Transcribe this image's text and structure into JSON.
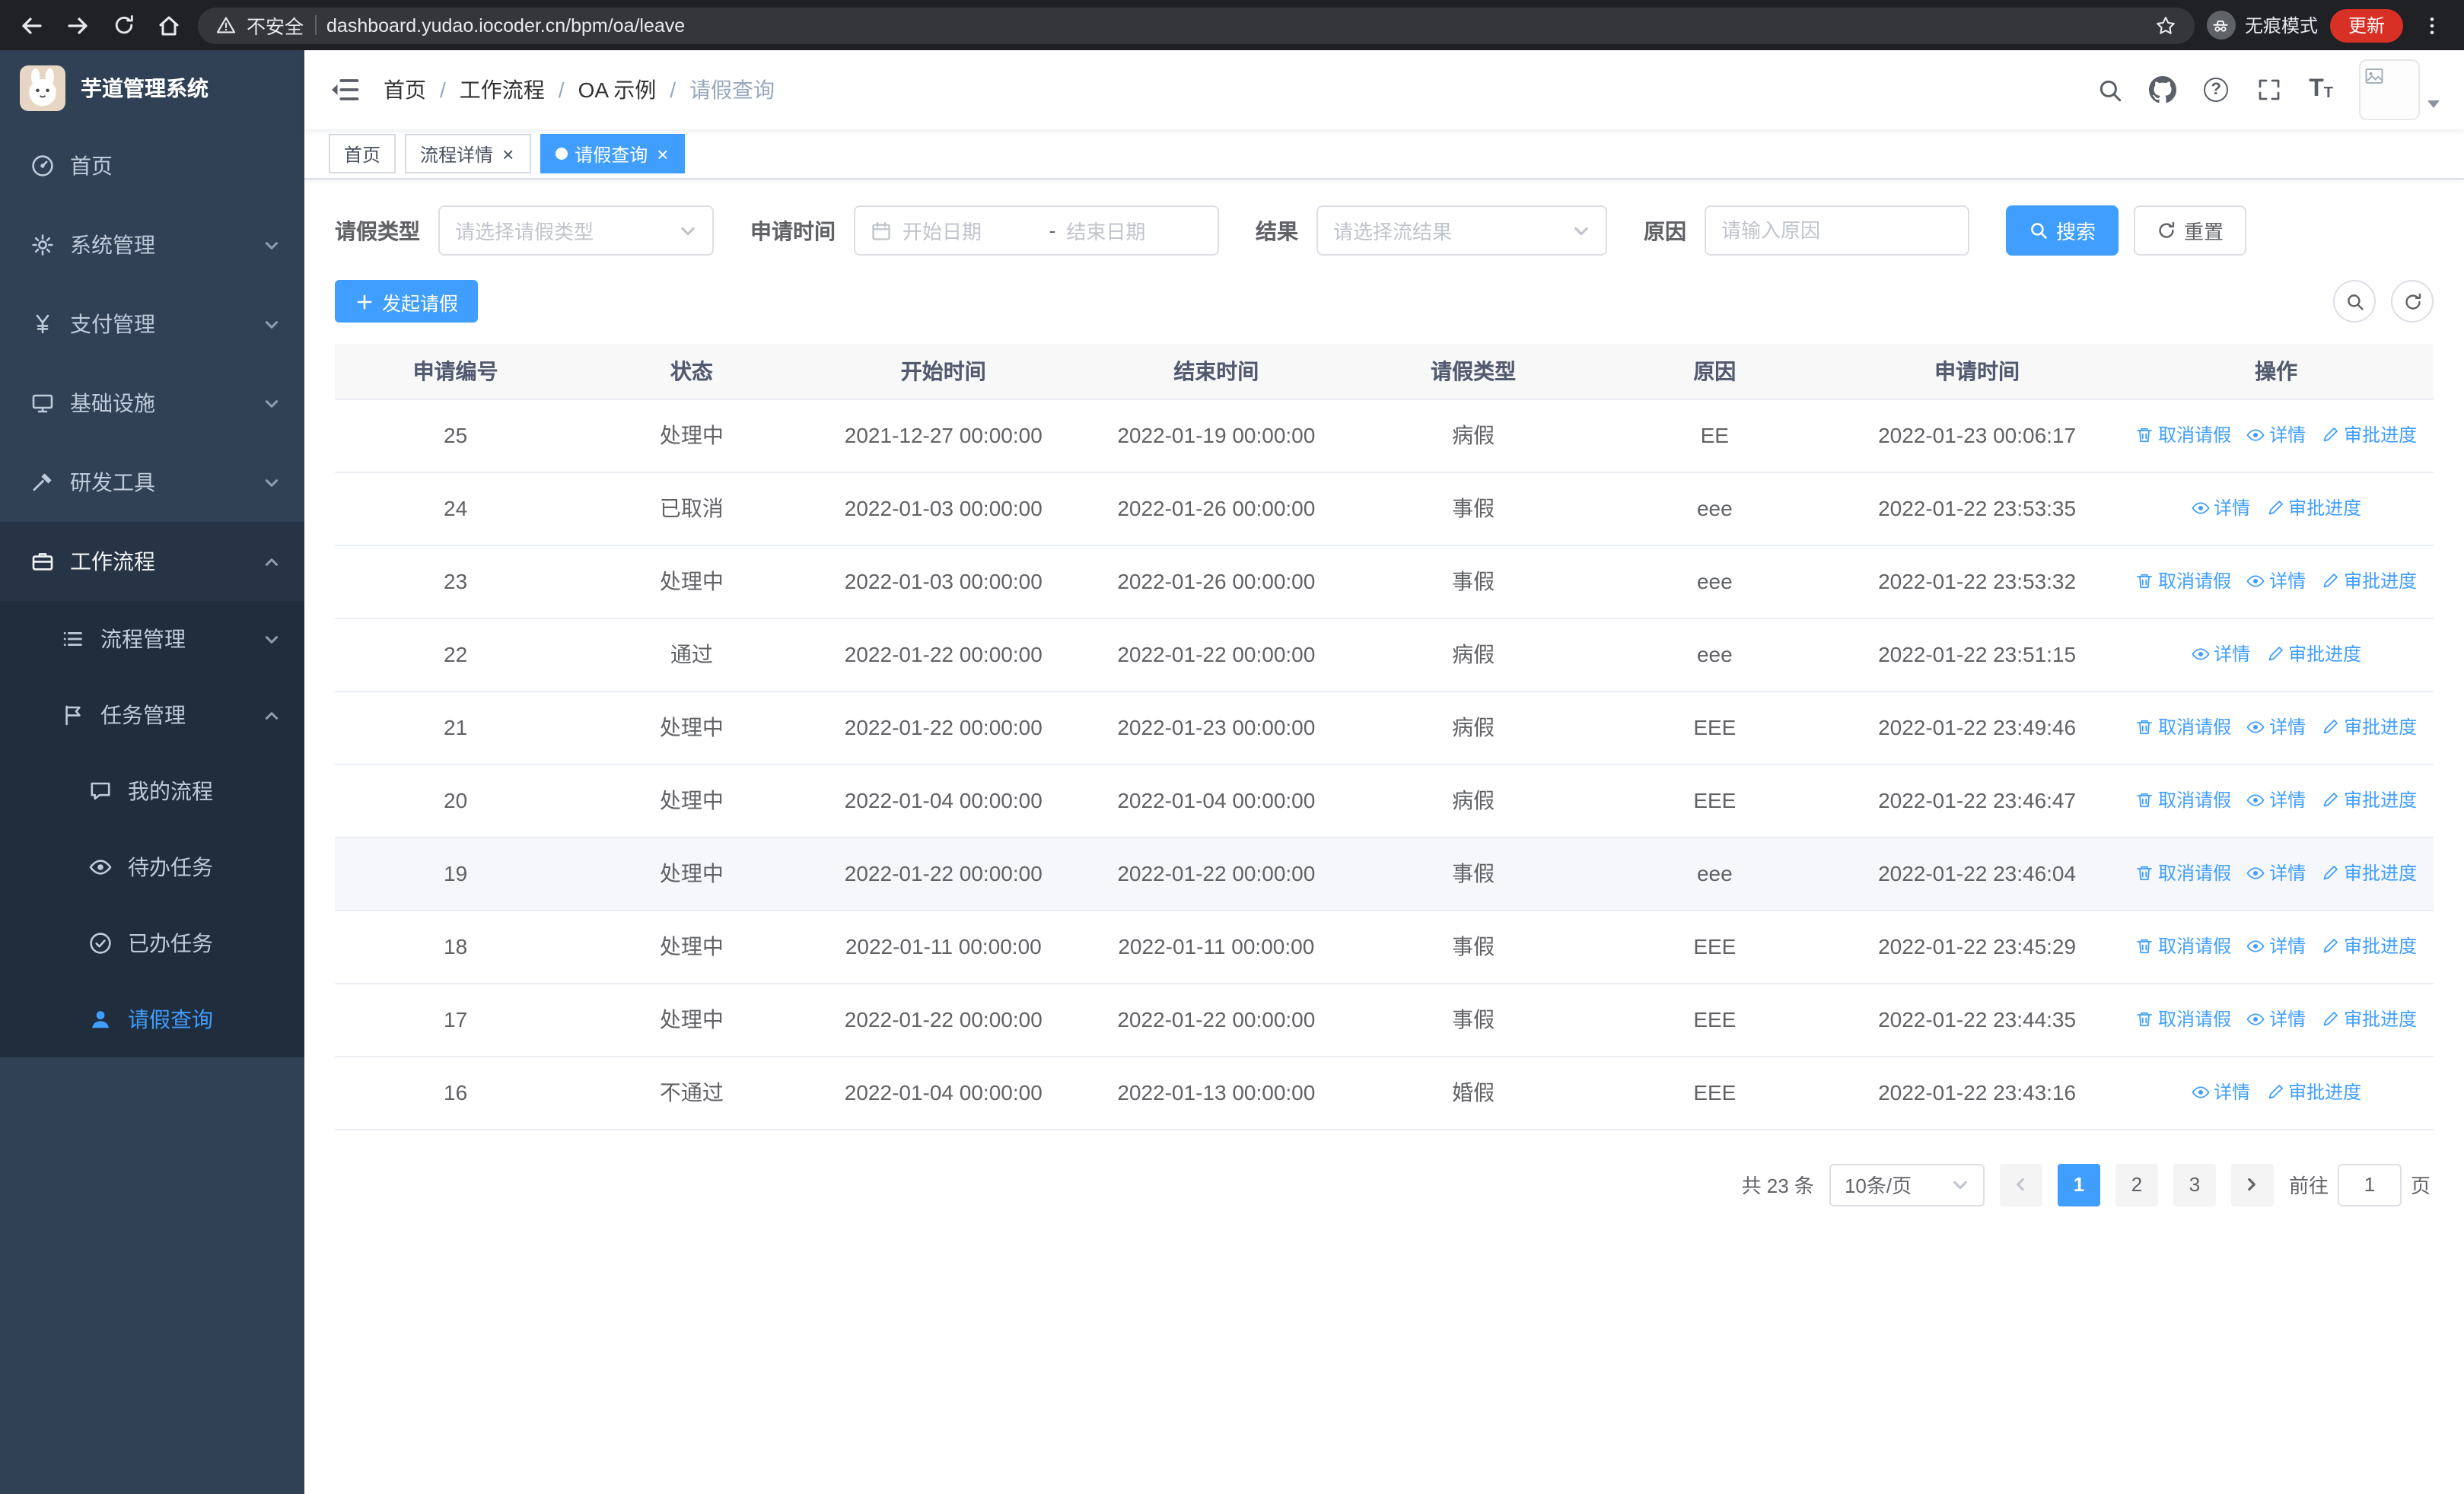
{
  "theme": {
    "primary": "#409eff",
    "sidebar_bg": "#304156",
    "submenu_bg": "#1f2d3d",
    "danger": "#d93025"
  },
  "browser": {
    "security_warning": "不安全",
    "url": "dashboard.yudao.iocoder.cn/bpm/oa/leave",
    "incognito_label": "无痕模式",
    "update_label": "更新"
  },
  "sidebar": {
    "logo_title": "芋道管理系统",
    "items": [
      {
        "label": "首页"
      },
      {
        "label": "系统管理"
      },
      {
        "label": "支付管理"
      },
      {
        "label": "基础设施"
      },
      {
        "label": "研发工具"
      },
      {
        "label": "工作流程"
      },
      {
        "label": "流程管理"
      },
      {
        "label": "任务管理"
      },
      {
        "label": "我的流程"
      },
      {
        "label": "待办任务"
      },
      {
        "label": "已办任务"
      },
      {
        "label": "请假查询"
      }
    ]
  },
  "breadcrumb": {
    "separator": "/",
    "items": [
      "首页",
      "工作流程",
      "OA 示例",
      "请假查询"
    ]
  },
  "tabs": [
    {
      "label": "首页"
    },
    {
      "label": "流程详情"
    },
    {
      "label": "请假查询"
    }
  ],
  "filters": {
    "leave_type_label": "请假类型",
    "leave_type_placeholder": "请选择请假类型",
    "apply_time_label": "申请时间",
    "start_date_placeholder": "开始日期",
    "range_separator": "-",
    "end_date_placeholder": "结束日期",
    "result_label": "结果",
    "result_placeholder": "请选择流结果",
    "reason_label": "原因",
    "reason_placeholder": "请输入原因",
    "search_button": "搜索",
    "reset_button": "重置"
  },
  "toolbar": {
    "create_button": "发起请假"
  },
  "table": {
    "columns": [
      "申请编号",
      "状态",
      "开始时间",
      "结束时间",
      "请假类型",
      "原因",
      "申请时间",
      "操作"
    ],
    "actions": {
      "cancel": "取消请假",
      "detail": "详情",
      "progress": "审批进度"
    },
    "highlighted_row_id": "19",
    "rows": [
      {
        "id": "25",
        "status": "处理中",
        "start_time": "2021-12-27 00:00:00",
        "end_time": "2022-01-19 00:00:00",
        "leave_type": "病假",
        "reason": "EE",
        "apply_time": "2022-01-23 00:06:17",
        "cancellable": true
      },
      {
        "id": "24",
        "status": "已取消",
        "start_time": "2022-01-03 00:00:00",
        "end_time": "2022-01-26 00:00:00",
        "leave_type": "事假",
        "reason": "eee",
        "apply_time": "2022-01-22 23:53:35",
        "cancellable": false
      },
      {
        "id": "23",
        "status": "处理中",
        "start_time": "2022-01-03 00:00:00",
        "end_time": "2022-01-26 00:00:00",
        "leave_type": "事假",
        "reason": "eee",
        "apply_time": "2022-01-22 23:53:32",
        "cancellable": true
      },
      {
        "id": "22",
        "status": "通过",
        "start_time": "2022-01-22 00:00:00",
        "end_time": "2022-01-22 00:00:00",
        "leave_type": "病假",
        "reason": "eee",
        "apply_time": "2022-01-22 23:51:15",
        "cancellable": false
      },
      {
        "id": "21",
        "status": "处理中",
        "start_time": "2022-01-22 00:00:00",
        "end_time": "2022-01-23 00:00:00",
        "leave_type": "病假",
        "reason": "EEE",
        "apply_time": "2022-01-22 23:49:46",
        "cancellable": true
      },
      {
        "id": "20",
        "status": "处理中",
        "start_time": "2022-01-04 00:00:00",
        "end_time": "2022-01-04 00:00:00",
        "leave_type": "病假",
        "reason": "EEE",
        "apply_time": "2022-01-22 23:46:47",
        "cancellable": true
      },
      {
        "id": "19",
        "status": "处理中",
        "start_time": "2022-01-22 00:00:00",
        "end_time": "2022-01-22 00:00:00",
        "leave_type": "事假",
        "reason": "eee",
        "apply_time": "2022-01-22 23:46:04",
        "cancellable": true
      },
      {
        "id": "18",
        "status": "处理中",
        "start_time": "2022-01-11 00:00:00",
        "end_time": "2022-01-11 00:00:00",
        "leave_type": "事假",
        "reason": "EEE",
        "apply_time": "2022-01-22 23:45:29",
        "cancellable": true
      },
      {
        "id": "17",
        "status": "处理中",
        "start_time": "2022-01-22 00:00:00",
        "end_time": "2022-01-22 00:00:00",
        "leave_type": "事假",
        "reason": "EEE",
        "apply_time": "2022-01-22 23:44:35",
        "cancellable": true
      },
      {
        "id": "16",
        "status": "不通过",
        "start_time": "2022-01-04 00:00:00",
        "end_time": "2022-01-13 00:00:00",
        "leave_type": "婚假",
        "reason": "EEE",
        "apply_time": "2022-01-22 23:43:16",
        "cancellable": false
      }
    ]
  },
  "pagination": {
    "total_label": "共 23 条",
    "page_size_label": "10条/页",
    "pages": [
      "1",
      "2",
      "3"
    ],
    "active_page": "1",
    "goto_prefix": "前往",
    "goto_value": "1",
    "goto_suffix": "页"
  }
}
